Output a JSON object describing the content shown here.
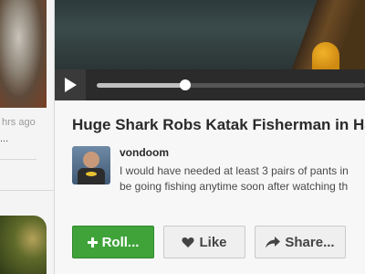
{
  "sidebar": {
    "time_text": "hrs ago",
    "ellipsis": "..."
  },
  "video": {
    "progress": 0.33
  },
  "post": {
    "title": "Huge Shark Robs Katak Fisherman in Hav",
    "comment": {
      "username": "vondoom",
      "line1": "I would have needed at least 3 pairs of pants in",
      "line2": "be going fishing anytime soon after watching th"
    }
  },
  "actions": {
    "roll_label": "Roll...",
    "like_label": "Like",
    "share_label": "Share..."
  },
  "colors": {
    "roll_green": "#3fa33a",
    "title_text": "#2a2a2a"
  },
  "icons": [
    "play-icon",
    "plus-icon",
    "heart-icon",
    "share-arrow-icon"
  ]
}
